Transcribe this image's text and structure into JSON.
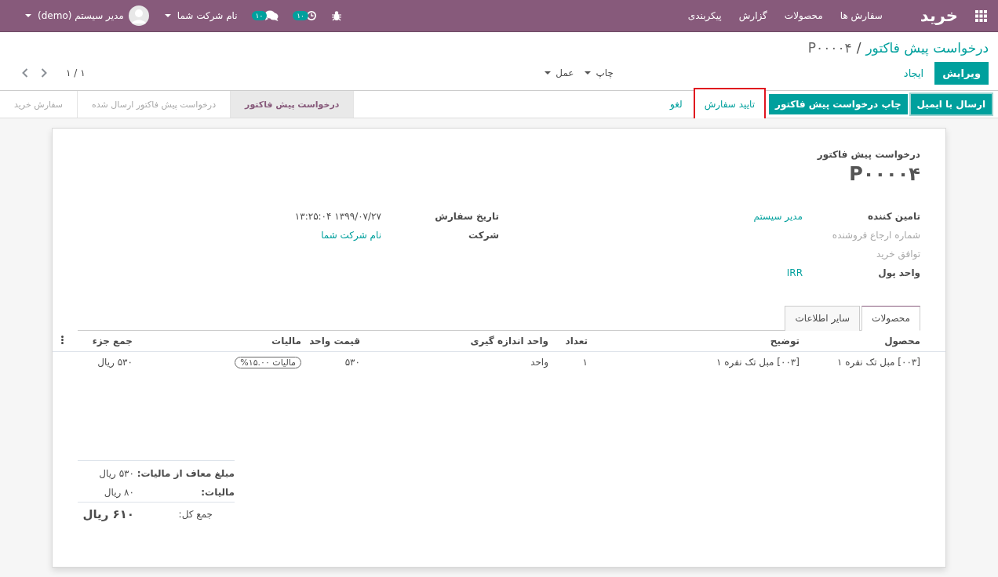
{
  "navbar": {
    "brand": "خرید",
    "menu": [
      "سفارش ها",
      "محصولات",
      "گزارش",
      "پیکربندی"
    ],
    "activity_count": "۱۰",
    "message_count": "۱۰",
    "company": "نام شرکت شما",
    "user": "مدیر سیستم (demo)"
  },
  "control_panel": {
    "breadcrumb_link": "درخواست پیش فاکتور",
    "breadcrumb_separator": "/",
    "breadcrumb_current": "P۰۰۰۰۴",
    "edit_button": "ویرایش",
    "create_button": "ایجاد",
    "dropdowns": [
      "چاپ",
      "عمل"
    ],
    "pager": "۱ / ۱"
  },
  "statusbar": {
    "buttons": [
      {
        "label": "ارسال با ایمیل",
        "kind": "primary",
        "highlighted": false
      },
      {
        "label": "چاپ درخواست پیش فاکتور",
        "kind": "primary",
        "highlighted": false
      },
      {
        "label": "تایید سفارش",
        "kind": "secondary",
        "highlighted": true
      },
      {
        "label": "لغو",
        "kind": "link",
        "highlighted": false
      }
    ],
    "stages": [
      {
        "label": "درخواست پیش فاکتور",
        "selected": true
      },
      {
        "label": "درخواست پیش فاکتور ارسال شده",
        "selected": false
      },
      {
        "label": "سفارش خرید",
        "selected": false
      }
    ]
  },
  "sheet": {
    "subtitle": "درخواست پیش فاکتور",
    "name": "P۰۰۰۰۴",
    "fields_right": [
      {
        "label": "تامین کننده",
        "value": "مدیر سیستم",
        "empty": false
      },
      {
        "label": "شماره ارجاع فروشنده",
        "empty": true
      },
      {
        "label": "توافق خرید",
        "empty": true
      },
      {
        "label": "واحد پول",
        "value": "IRR",
        "empty": false
      }
    ],
    "fields_left": [
      {
        "label": "تاریخ سفارش",
        "value": "۱۳۹۹/۰۷/۲۷ ۱۳:۲۵:۰۴",
        "kind": "text"
      },
      {
        "label": "شرکت",
        "value": "نام شرکت شما",
        "kind": "link"
      }
    ],
    "tabs": [
      {
        "label": "محصولات",
        "selected": true
      },
      {
        "label": "سایر اطلاعات",
        "selected": false
      }
    ],
    "table": {
      "columns": [
        "محصول",
        "توضیح",
        "تعداد",
        "واحد اندازه گیری",
        "قیمت واحد",
        "مالیات",
        "جمع جزء"
      ],
      "rows": [
        {
          "product": "[۰۰۳] مبل تک نفره ۱",
          "description": "[۰۰۳] مبل تک نفره ۱",
          "quantity": "۱",
          "uom": "واحد",
          "unit_price": "۵۳۰",
          "tax": "مالیات ۱۵.۰۰%",
          "subtotal": "۵۳۰ ریال"
        }
      ]
    },
    "totals": [
      {
        "label": "مبلغ معاف از مالیات:",
        "value": "۵۳۰ ریال",
        "kind": "line"
      },
      {
        "label": "مالیات:",
        "value": "۸۰ ریال",
        "kind": "line"
      },
      {
        "label": "جمع کل:",
        "value": "۶۱۰ ریال",
        "kind": "grand"
      }
    ]
  }
}
